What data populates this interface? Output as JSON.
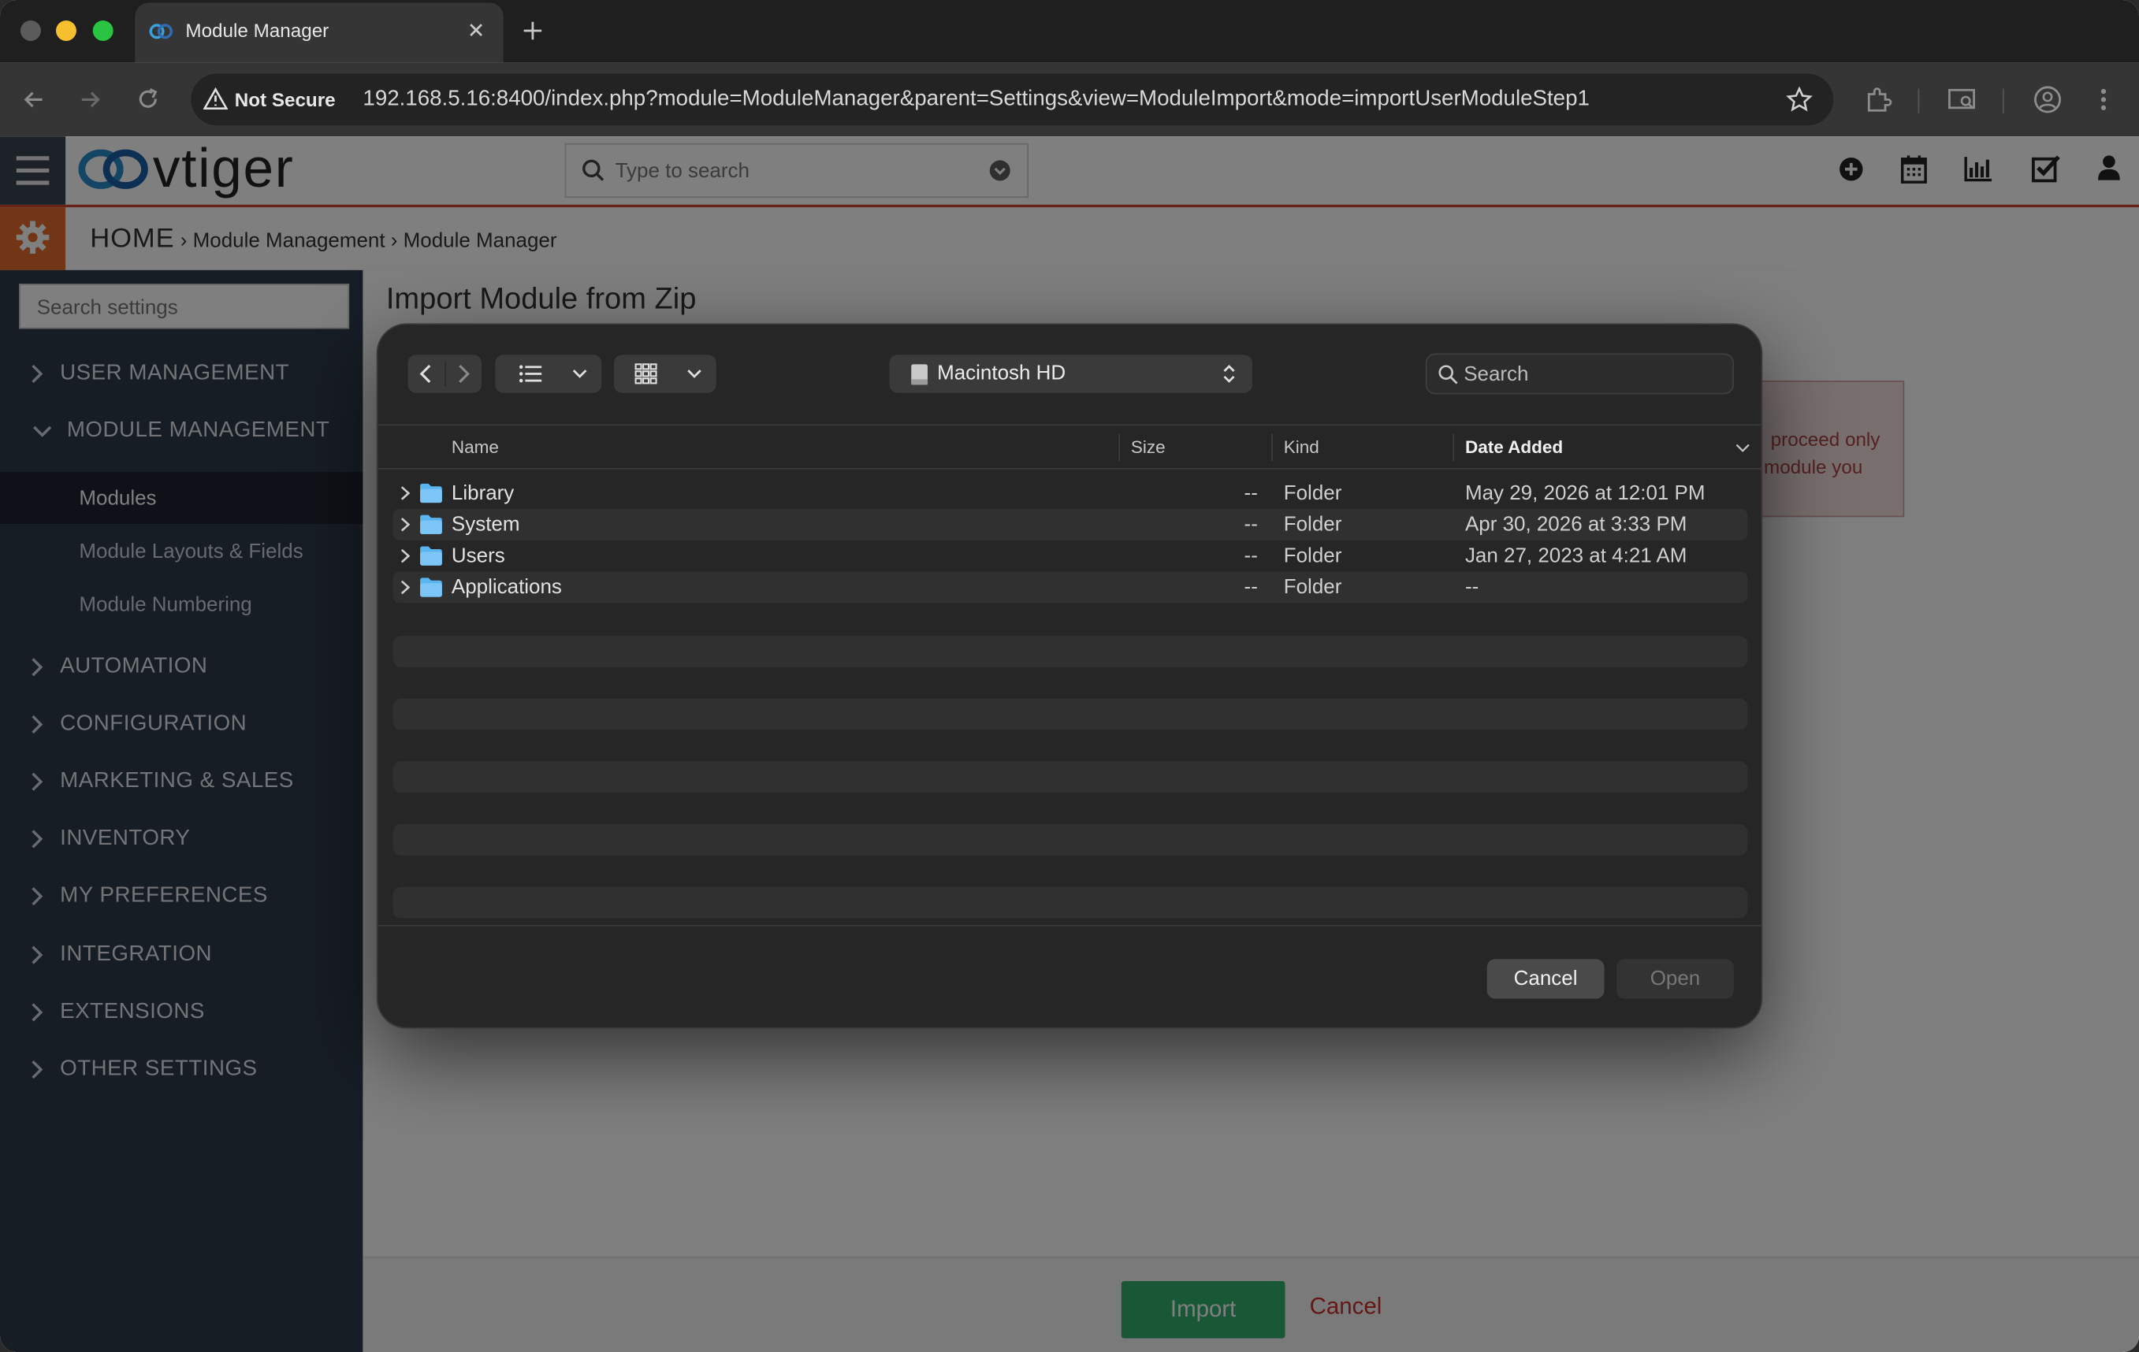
{
  "browser": {
    "tab_title": "Module Manager",
    "security_label": "Not Secure",
    "url": "192.168.5.16:8400/index.php?module=ModuleManager&parent=Settings&view=ModuleImport&mode=importUserModuleStep1"
  },
  "header": {
    "logo_text": "vtiger",
    "search_placeholder": "Type to search"
  },
  "breadcrumb": {
    "home": "HOME",
    "items": [
      "Module Management",
      "Module Manager"
    ]
  },
  "sidebar": {
    "search_placeholder": "Search settings",
    "categories": [
      {
        "label": "USER MANAGEMENT",
        "expanded": false
      },
      {
        "label": "MODULE MANAGEMENT",
        "expanded": true
      },
      {
        "label": "AUTOMATION",
        "expanded": false
      },
      {
        "label": "CONFIGURATION",
        "expanded": false
      },
      {
        "label": "MARKETING & SALES",
        "expanded": false
      },
      {
        "label": "INVENTORY",
        "expanded": false
      },
      {
        "label": "MY PREFERENCES",
        "expanded": false
      },
      {
        "label": "INTEGRATION",
        "expanded": false
      },
      {
        "label": "EXTENSIONS",
        "expanded": false
      },
      {
        "label": "OTHER SETTINGS",
        "expanded": false
      }
    ],
    "module_items": [
      "Modules",
      "Module Layouts & Fields",
      "Module Numbering"
    ],
    "active_item": "Modules"
  },
  "main": {
    "title": "Import Module from Zip",
    "warning_line1": "proceed only",
    "warning_line2": "module you",
    "import_button": "Import",
    "cancel_link": "Cancel"
  },
  "dialog": {
    "location": "Macintosh HD",
    "search_placeholder": "Search",
    "columns": {
      "name": "Name",
      "size": "Size",
      "kind": "Kind",
      "date_added": "Date Added"
    },
    "files": [
      {
        "name": "Library",
        "size": "--",
        "kind": "Folder",
        "date_added": "May 29, 2026 at 12:01 PM"
      },
      {
        "name": "System",
        "size": "--",
        "kind": "Folder",
        "date_added": "Apr 30, 2026 at 3:33 PM"
      },
      {
        "name": "Users",
        "size": "--",
        "kind": "Folder",
        "date_added": "Jan 27, 2023 at 4:21 AM"
      },
      {
        "name": "Applications",
        "size": "--",
        "kind": "Folder",
        "date_added": "--"
      }
    ],
    "cancel_button": "Cancel",
    "open_button": "Open"
  },
  "colors": {
    "accent_orange": "#e56b2c",
    "header_rule": "#d04a2f",
    "sidebar_bg": "#2f3a4a",
    "dialog_bg": "#262626",
    "folder_blue": "#5ab4f0"
  }
}
